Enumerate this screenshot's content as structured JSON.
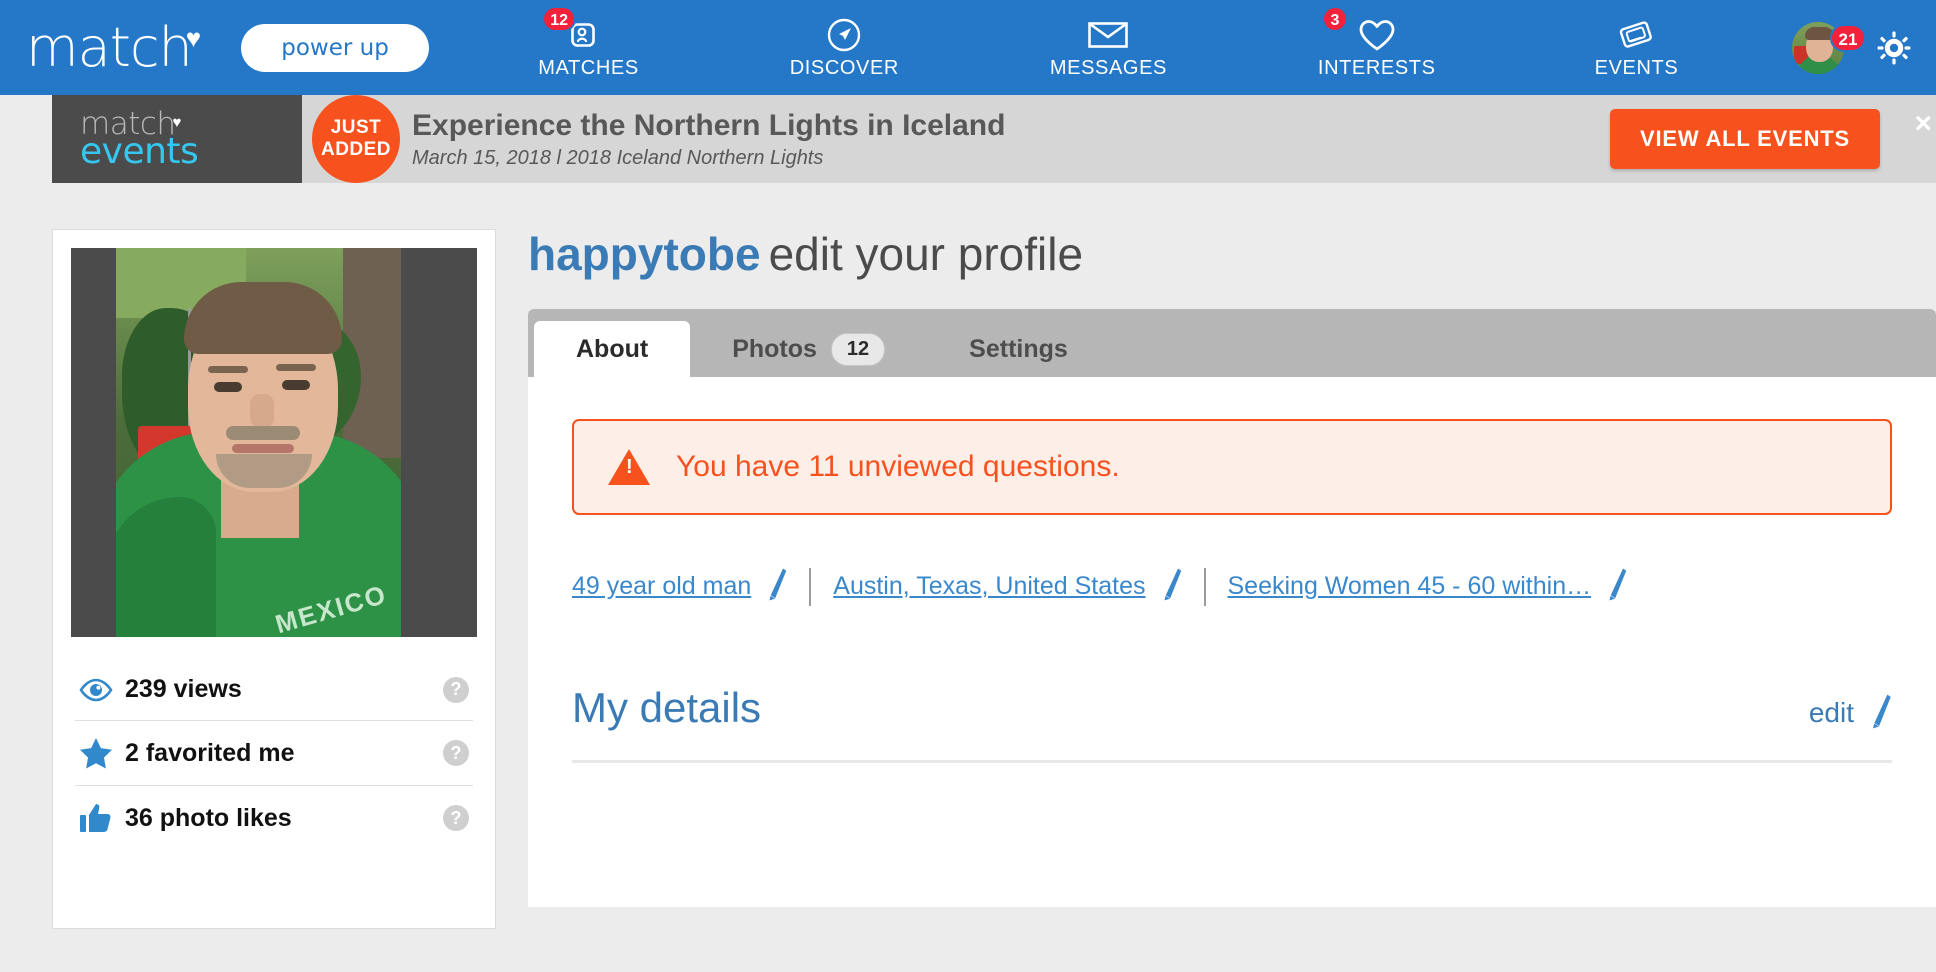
{
  "topnav": {
    "brand": {
      "word": "match",
      "heart_icon": "heart-icon"
    },
    "power_up_label": "power up",
    "items": [
      {
        "label": "MATCHES",
        "badge": "12",
        "icon": "matches-icon"
      },
      {
        "label": "DISCOVER",
        "badge": "",
        "icon": "compass-icon"
      },
      {
        "label": "MESSAGES",
        "badge": "",
        "icon": "envelope-icon"
      },
      {
        "label": "INTERESTS",
        "badge": "3",
        "icon": "heart-outline-icon"
      },
      {
        "label": "EVENTS",
        "badge": "",
        "icon": "ticket-icon"
      }
    ],
    "avatar_badge": "21",
    "gear_icon": "gear-icon",
    "accent_color": "#2577c7",
    "badge_color": "#f4213a"
  },
  "banner": {
    "logo_line1": "match",
    "logo_line2": "events",
    "flag_line1": "JUST",
    "flag_line2": "ADDED",
    "title": "Experience the Northern Lights in Iceland",
    "subtitle": "March 15, 2018 l 2018 Iceland Northern Lights",
    "cta_label": "VIEW ALL EVENTS",
    "close_label": "×",
    "accent_color": "#f7511e"
  },
  "sidebar": {
    "photo_alt": "profile-photo",
    "photo_shirt_text": "MEXICO",
    "stats": [
      {
        "icon": "eye-icon",
        "label": "239 views",
        "help": "?"
      },
      {
        "icon": "star-icon",
        "label": "2 favorited me",
        "help": "?"
      },
      {
        "icon": "thumbs-up-icon",
        "label": "36 photo likes",
        "help": "?"
      }
    ]
  },
  "main": {
    "username": "happytobe",
    "subtitle": "edit your profile",
    "tabs": [
      {
        "label": "About",
        "count": "",
        "active": true
      },
      {
        "label": "Photos",
        "count": "12",
        "active": false
      },
      {
        "label": "Settings",
        "count": "",
        "active": false
      }
    ],
    "alert": {
      "icon": "warning-icon",
      "text": "You have 11 unviewed questions."
    },
    "detail_links": [
      {
        "text": "49 year old man",
        "edit_icon": "pencil-icon"
      },
      {
        "text": "Austin, Texas, United States",
        "edit_icon": "pencil-icon"
      },
      {
        "text": "Seeking Women 45 - 60 within…",
        "edit_icon": "pencil-icon"
      }
    ],
    "section": {
      "title": "My details",
      "edit_label": "edit",
      "edit_icon": "pencil-icon"
    }
  }
}
